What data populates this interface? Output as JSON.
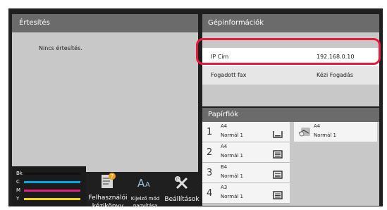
{
  "notifications": {
    "title": "Értesítés",
    "message": "Nincs értesítés."
  },
  "machine_info": {
    "title": "Gépinformációk",
    "ip_label": "IP Cím",
    "ip_value": "192.168.0.10",
    "fax_label": "Fogadott fax",
    "fax_value": "Kézi Fogadás"
  },
  "toner": {
    "items": [
      {
        "label": "Bk",
        "color": "#111111",
        "level": 1.0
      },
      {
        "label": "C",
        "color": "#00a8e8",
        "level": 1.0
      },
      {
        "label": "M",
        "color": "#e0207a",
        "level": 1.0
      },
      {
        "label": "Y",
        "color": "#f5d400",
        "level": 1.0
      }
    ]
  },
  "buttons": {
    "manual": {
      "line1": "Felhasználói",
      "line2": "kézikönyv",
      "icon": "manual-icon"
    },
    "zoom": {
      "line1": "Kijelző mód",
      "line2": "nagyítása",
      "icon": "text-zoom-icon"
    },
    "settings": {
      "line1": "Beállítások",
      "icon": "tools-icon"
    }
  },
  "paper_trays": {
    "title": "Papírfiók",
    "trays": [
      {
        "number": "1",
        "size": "A4",
        "type": "Normál 1",
        "icon": "tray-empty-icon"
      },
      {
        "number": "2",
        "size": "A4",
        "type": "Normál 1",
        "icon": "tray-loaded-icon"
      },
      {
        "number": "3",
        "size": "B4",
        "type": "Normál 1",
        "icon": "tray-loaded-icon"
      },
      {
        "number": "4",
        "size": "A3",
        "type": "Normál 1",
        "icon": "tray-loaded-icon"
      }
    ],
    "bypass": {
      "size": "A4",
      "type": "Normál 1",
      "icon": "bypass-tray-icon"
    }
  },
  "colors": {
    "highlight": "#e41c3c",
    "header": "#6b6b6b",
    "panel": "#c8c8c8"
  }
}
